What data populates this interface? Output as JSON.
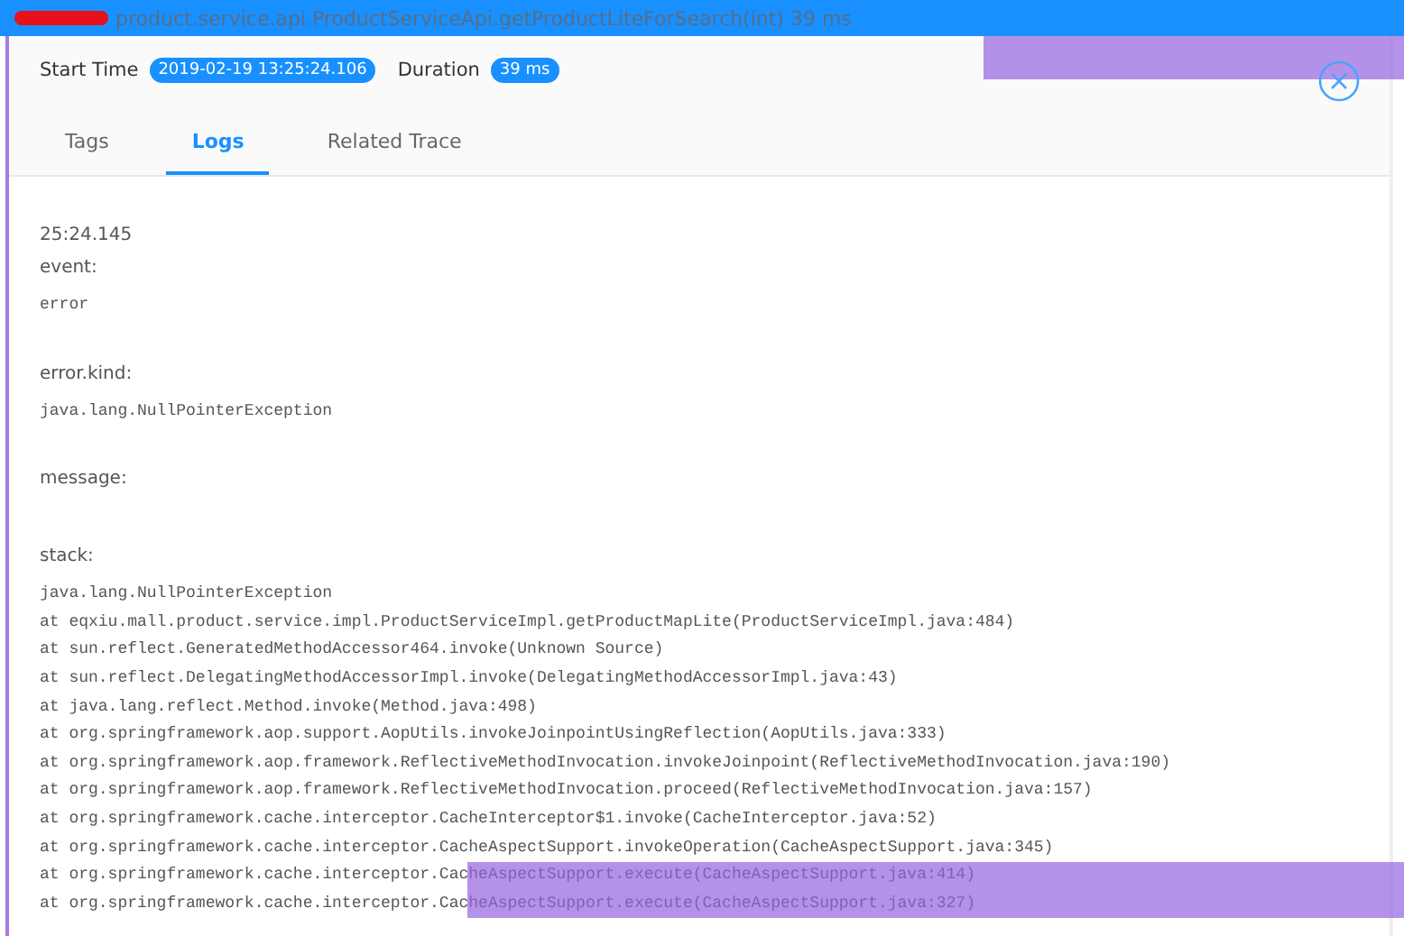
{
  "header": {
    "title": "product.service.api.ProductServiceApi.getProductLiteForSearch(int) 39 ms"
  },
  "summary": {
    "start_label": "Start Time",
    "start_time": "2019-02-19 13:25:24.106",
    "duration_label": "Duration",
    "duration": "39 ms"
  },
  "tabs": [
    {
      "label": "Tags",
      "selected": false
    },
    {
      "label": "Logs",
      "selected": true
    },
    {
      "label": "Related Trace",
      "selected": false
    }
  ],
  "log": {
    "time": "25:24.145",
    "fields": [
      {
        "label": "event:",
        "lines": [
          "error"
        ]
      },
      {
        "label": "error.kind:",
        "lines": [
          "java.lang.NullPointerException"
        ]
      },
      {
        "label": "message:"
      },
      {
        "label": "stack:",
        "lines": [
          "java.lang.NullPointerException",
          "at eqxiu.mall.product.service.impl.ProductServiceImpl.getProductMapLite(ProductServiceImpl.java:484)",
          "at sun.reflect.GeneratedMethodAccessor464.invoke(Unknown Source)",
          "at sun.reflect.DelegatingMethodAccessorImpl.invoke(DelegatingMethodAccessorImpl.java:43)",
          "at java.lang.reflect.Method.invoke(Method.java:498)",
          "at org.springframework.aop.support.AopUtils.invokeJoinpointUsingReflection(AopUtils.java:333)",
          "at org.springframework.aop.framework.ReflectiveMethodInvocation.invokeJoinpoint(ReflectiveMethodInvocation.java:190)",
          "at org.springframework.aop.framework.ReflectiveMethodInvocation.proceed(ReflectiveMethodInvocation.java:157)",
          "at org.springframework.cache.interceptor.CacheInterceptor$1.invoke(CacheInterceptor.java:52)",
          "at org.springframework.cache.interceptor.CacheAspectSupport.invokeOperation(CacheAspectSupport.java:345)",
          "at org.springframework.cache.interceptor.CacheAspectSupport.execute(CacheAspectSupport.java:414)",
          "at org.springframework.cache.interceptor.CacheAspectSupport.execute(CacheAspectSupport.java:327)"
        ]
      }
    ]
  }
}
